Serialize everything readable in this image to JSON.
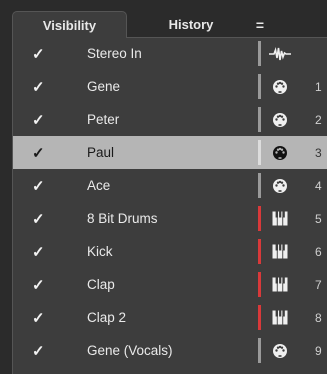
{
  "tabs": {
    "visibility": "Visibility",
    "history": "History",
    "menu": "="
  },
  "tracks": [
    {
      "checked": "✓",
      "name": "Stereo In",
      "icon": "waveform-icon",
      "num": "",
      "sep": "gray",
      "selected": false
    },
    {
      "checked": "✓",
      "name": "Gene",
      "icon": "midi-icon",
      "num": "1",
      "sep": "gray",
      "selected": false
    },
    {
      "checked": "✓",
      "name": "Peter",
      "icon": "midi-icon",
      "num": "2",
      "sep": "gray",
      "selected": false
    },
    {
      "checked": "✓",
      "name": "Paul",
      "icon": "midi-icon",
      "num": "3",
      "sep": "gray",
      "selected": true
    },
    {
      "checked": "✓",
      "name": "Ace",
      "icon": "midi-icon",
      "num": "4",
      "sep": "gray",
      "selected": false
    },
    {
      "checked": "✓",
      "name": "8 Bit Drums",
      "icon": "keyboard-icon",
      "num": "5",
      "sep": "red",
      "selected": false
    },
    {
      "checked": "✓",
      "name": "Kick",
      "icon": "keyboard-icon",
      "num": "6",
      "sep": "red",
      "selected": false
    },
    {
      "checked": "✓",
      "name": "Clap",
      "icon": "keyboard-icon",
      "num": "7",
      "sep": "red",
      "selected": false
    },
    {
      "checked": "✓",
      "name": "Clap 2",
      "icon": "keyboard-icon",
      "num": "8",
      "sep": "red",
      "selected": false
    },
    {
      "checked": "✓",
      "name": "Gene (Vocals)",
      "icon": "midi-icon",
      "num": "9",
      "sep": "gray",
      "selected": false
    }
  ],
  "colors": {
    "background": "#2b2b2b",
    "panel": "#3d3d3d",
    "selected_row": "#b5b5b5",
    "instrument_separator": "#d9393a"
  }
}
